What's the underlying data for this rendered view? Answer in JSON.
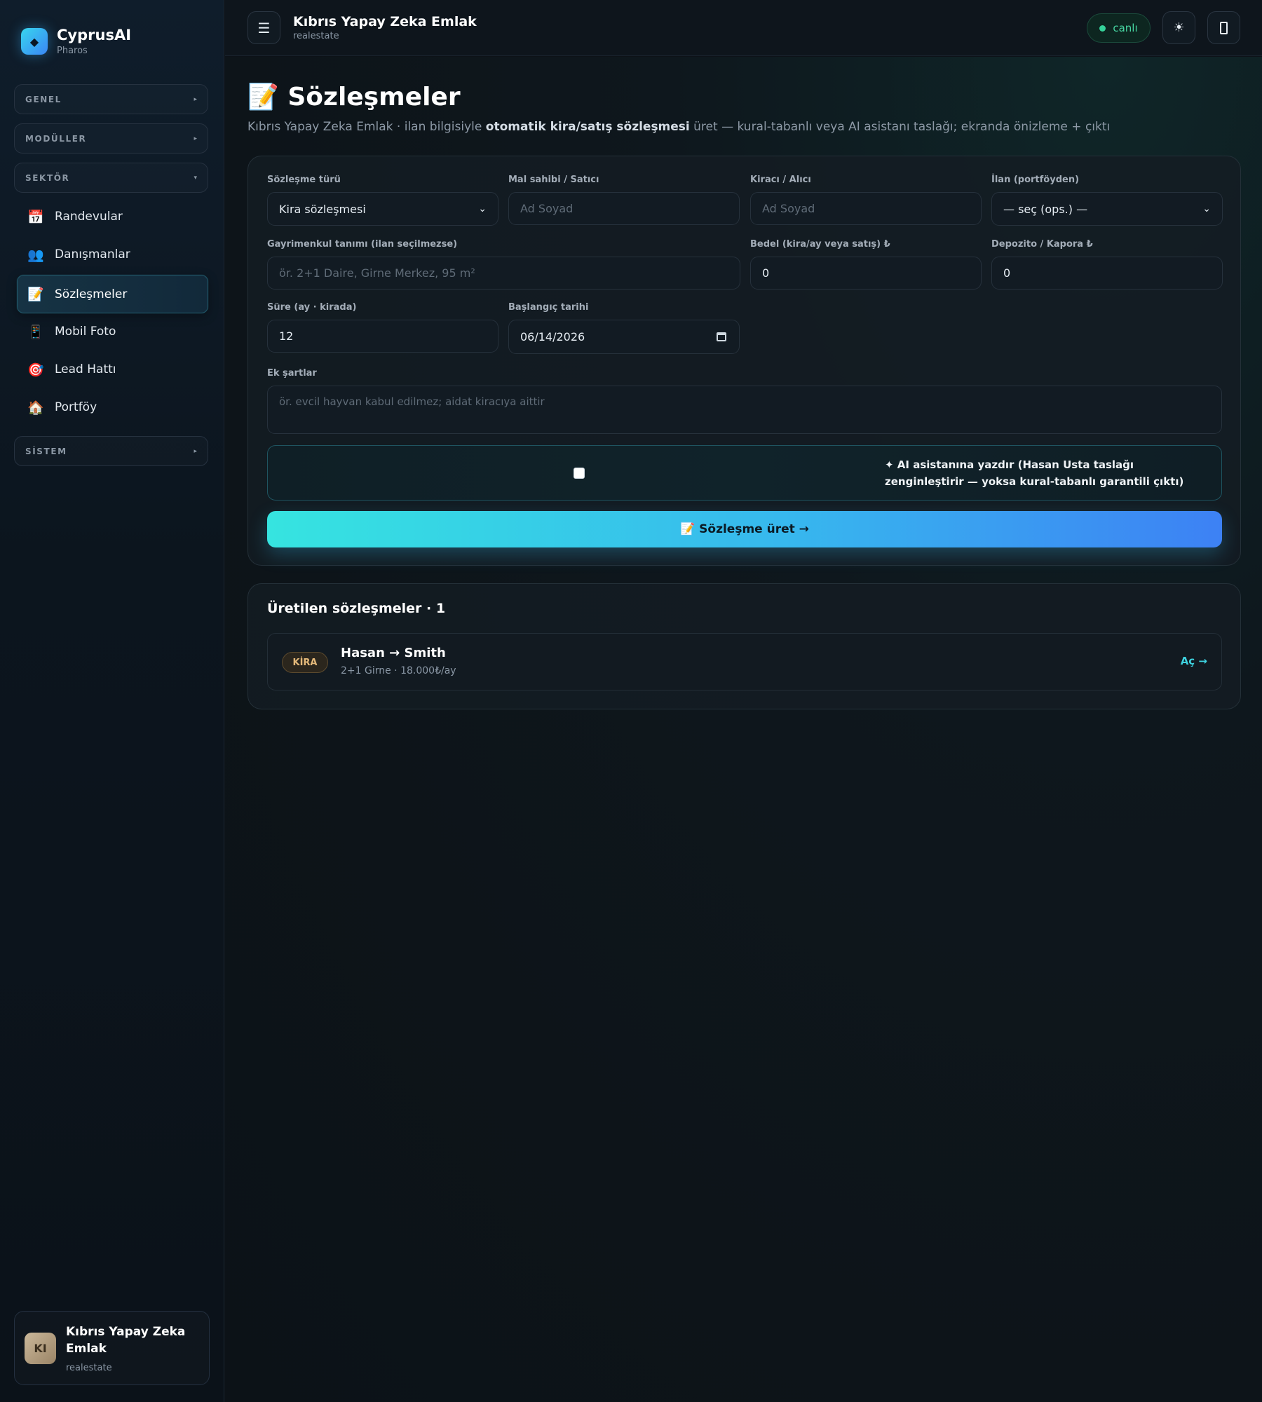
{
  "brand": {
    "name": "CyprusAI",
    "sub": "Pharos",
    "logo_glyph": "◆"
  },
  "sidebar": {
    "sections": {
      "genel": {
        "label": "GENEL",
        "caret": "▸"
      },
      "moduller": {
        "label": "MODÜLLER",
        "caret": "▸"
      },
      "sektor": {
        "label": "SEKTÖR",
        "caret": "▾"
      },
      "sistem": {
        "label": "SİSTEM",
        "caret": "▸"
      }
    },
    "items": [
      {
        "icon": "📅",
        "label": "Randevular"
      },
      {
        "icon": "👥",
        "label": "Danışmanlar"
      },
      {
        "icon": "📝",
        "label": "Sözleşmeler",
        "active": true
      },
      {
        "icon": "📱",
        "label": "Mobil Foto"
      },
      {
        "icon": "🎯",
        "label": "Lead Hattı"
      },
      {
        "icon": "🏠",
        "label": "Portföy"
      }
    ],
    "org": {
      "initials": "KI",
      "name": "Kıbrıs Yapay Zeka Emlak",
      "sub": "realestate"
    }
  },
  "topbar": {
    "menu_glyph": "☰",
    "title": "Kıbrıs Yapay Zeka Emlak",
    "subtitle": "realestate",
    "status": "canlı",
    "theme_glyph": "☀"
  },
  "page": {
    "title": "📝 Sözleşmeler",
    "desc_pre": "Kıbrıs Yapay Zeka Emlak · ilan bilgisiyle ",
    "desc_bold": "otomatik kira/satış sözleşmesi",
    "desc_post": " üret — kural-tabanlı veya AI asistanı taslağı; ekranda önizleme + çıktı"
  },
  "form": {
    "type": {
      "label": "Sözleşme türü",
      "value": "Kira sözleşmesi"
    },
    "owner": {
      "label": "Mal sahibi / Satıcı",
      "placeholder": "Ad Soyad"
    },
    "tenant": {
      "label": "Kiracı / Alıcı",
      "placeholder": "Ad Soyad"
    },
    "listing": {
      "label": "İlan (portföyden)",
      "value": "— seç (ops.) —"
    },
    "property": {
      "label": "Gayrimenkul tanımı (ilan seçilmezse)",
      "placeholder": "ör. 2+1 Daire, Girne Merkez, 95 m²"
    },
    "price": {
      "label": "Bedel (kira/ay veya satış) ₺",
      "value": "0"
    },
    "deposit": {
      "label": "Depozito / Kapora ₺",
      "value": "0"
    },
    "duration": {
      "label": "Süre (ay · kirada)",
      "value": "12"
    },
    "start": {
      "label": "Başlangıç tarihi",
      "value": "06/14/2026"
    },
    "extra": {
      "label": "Ek şartlar",
      "placeholder": "ör. evcil hayvan kabul edilmez; aidat kiracıya aittir"
    },
    "ai_option": "✦ AI asistanına yazdır (Hasan Usta taslağı zenginleştirir — yoksa kural-tabanlı garantili çıktı)",
    "submit": "📝 Sözleşme üret →"
  },
  "contracts": {
    "title": "Üretilen sözleşmeler · 1",
    "items": [
      {
        "badge": "KİRA",
        "title": "Hasan → Smith",
        "sub": "2+1 Girne · 18.000₺/ay",
        "link": "Aç →"
      }
    ]
  },
  "colors": {
    "accent": "#36e4e0",
    "accent_blue": "#3d81f4",
    "live_green": "#35d39a",
    "badge_gold": "#e4b97a"
  }
}
